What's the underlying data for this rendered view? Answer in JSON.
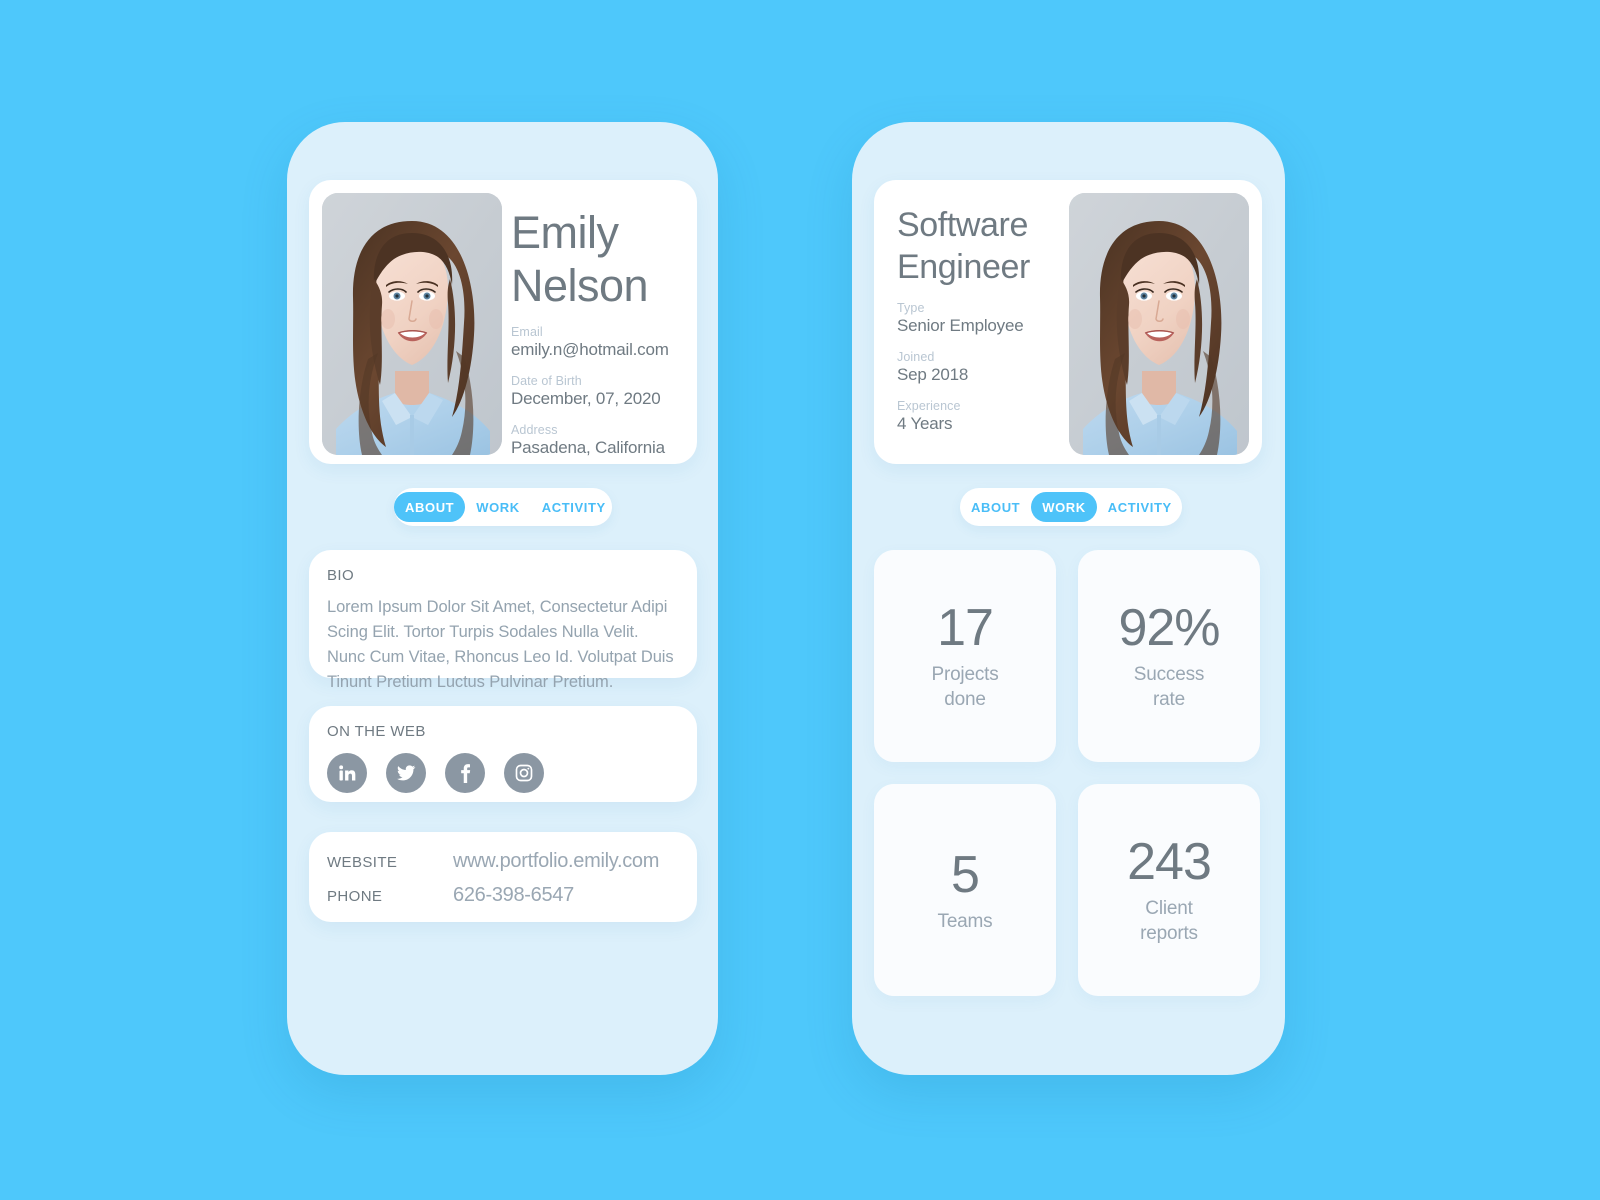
{
  "theme": {
    "background": "#4ec8fb",
    "phone_body": "#dcf0fb",
    "card": "#ffffff",
    "accent": "#4ec3f9",
    "text_dark": "#6f7a82",
    "text_muted": "#94a3af",
    "label_light": "#b9c6d2",
    "icon_circle": "#8b97a3"
  },
  "screen_about": {
    "profile": {
      "photo_alt": "portrait-photo",
      "first_name": "Emily",
      "last_name": "Nelson",
      "fields": [
        {
          "label": "Email",
          "value": "emily.n@hotmail.com"
        },
        {
          "label": "Date of Birth",
          "value": "December, 07, 2020"
        },
        {
          "label": "Address",
          "value": "Pasadena, California"
        }
      ]
    },
    "tabs": [
      {
        "label": "ABOUT",
        "active": true
      },
      {
        "label": "WORK",
        "active": false
      },
      {
        "label": "ACTIVITY",
        "active": false
      }
    ],
    "bio": {
      "title": "BIO",
      "text": "Lorem Ipsum Dolor Sit Amet, Consectetur Adipi Scing Elit. Tortor Turpis Sodales Nulla Velit. Nunc Cum Vitae, Rhoncus Leo Id. Volutpat  Duis Tinunt Pretium Luctus Pulvinar Pretium."
    },
    "on_the_web": {
      "title": "ON THE WEB",
      "icons": [
        {
          "name": "linkedin-icon"
        },
        {
          "name": "twitter-icon"
        },
        {
          "name": "facebook-icon"
        },
        {
          "name": "instagram-icon"
        }
      ]
    },
    "contact": [
      {
        "key": "WEBSITE",
        "value": "www.portfolio.emily.com"
      },
      {
        "key": "PHONE",
        "value": "626-398-6547"
      }
    ]
  },
  "screen_work": {
    "job": {
      "title_line1": "Software",
      "title_line2": "Engineer",
      "photo_alt": "portrait-photo",
      "fields": [
        {
          "label": "Type",
          "value": "Senior Employee"
        },
        {
          "label": "Joined",
          "value": "Sep 2018"
        },
        {
          "label": "Experience",
          "value": "4 Years"
        }
      ]
    },
    "tabs": [
      {
        "label": "ABOUT",
        "active": false
      },
      {
        "label": "WORK",
        "active": true
      },
      {
        "label": "ACTIVITY",
        "active": false
      }
    ],
    "stats": [
      {
        "value": "17",
        "label_line1": "Projects",
        "label_line2": "done"
      },
      {
        "value": "92%",
        "label_line1": "Success",
        "label_line2": "rate"
      },
      {
        "value": "5",
        "label_line1": "Teams",
        "label_line2": ""
      },
      {
        "value": "243",
        "label_line1": "Client",
        "label_line2": "reports"
      }
    ]
  }
}
